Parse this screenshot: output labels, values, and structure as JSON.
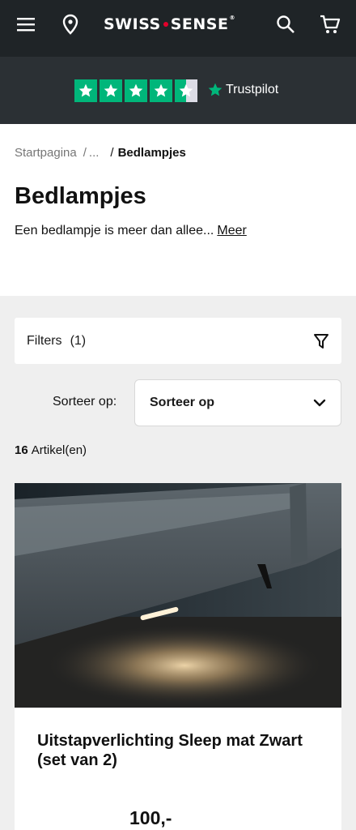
{
  "header": {
    "logo_left": "SWISS",
    "logo_right": "SENSE",
    "logo_mark": "®",
    "icons": [
      "menu-icon",
      "location-pin-icon",
      "search-icon",
      "cart-icon"
    ],
    "bg_color": "#1f2427"
  },
  "trustpilot": {
    "brand": "Trustpilot",
    "rating_stars": 4.5,
    "max_stars": 5,
    "star_color": "#00b67a"
  },
  "breadcrumb": {
    "home": "Startpagina",
    "sep1": "/",
    "ellipsis": "...",
    "sep2": "/",
    "current": "Bedlampjes"
  },
  "page": {
    "title": "Bedlampjes",
    "intro": "Een bedlampje is meer dan allee...",
    "more_link": "Meer"
  },
  "filters": {
    "label": "Filters",
    "count": "(1)"
  },
  "sort": {
    "label": "Sorteer op:",
    "selected": "Sorteer op"
  },
  "results": {
    "count": "16",
    "unit": "Artikel(en)"
  },
  "products": [
    {
      "title": "Uitstapverlichting Sleep mat Zwart (set van 2)",
      "price": "100,-"
    }
  ]
}
